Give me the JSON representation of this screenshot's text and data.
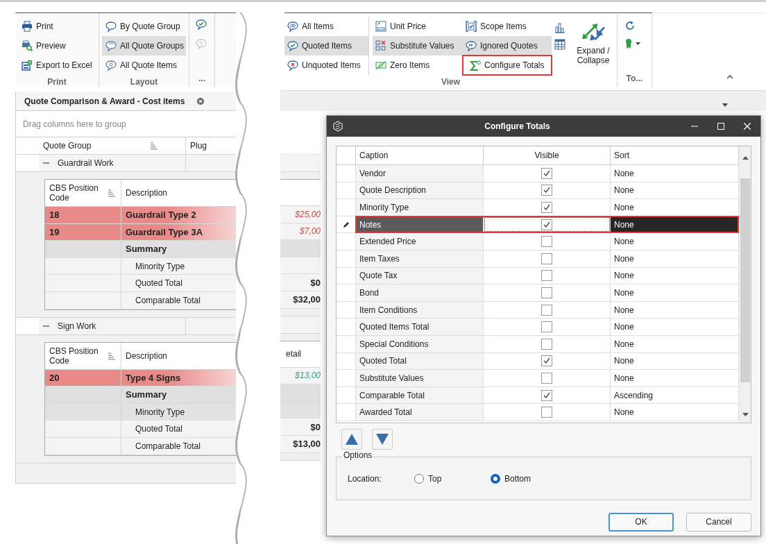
{
  "left_ribbon": {
    "groups": [
      {
        "label": "Print",
        "items": [
          {
            "label": "Print"
          },
          {
            "label": "Preview"
          },
          {
            "label": "Export to Excel"
          }
        ]
      },
      {
        "label": "Layout",
        "items": [
          {
            "label": "By Quote Group",
            "selected": false
          },
          {
            "label": "All Quote Groups",
            "selected": true
          },
          {
            "label": "All Quote Items",
            "selected": false
          }
        ]
      },
      {
        "label": "..."
      }
    ]
  },
  "document_tab": {
    "title": "Quote Comparison & Award - Cost items"
  },
  "group_panel": {
    "hint": "Drag columns here to group"
  },
  "grid": {
    "columns": [
      "Quote Group",
      "Plug"
    ],
    "groups": [
      {
        "name": "Guardrail Work",
        "expanded": true,
        "detail_columns": [
          "CBS Position Code",
          "Description"
        ],
        "rows": [
          {
            "kind": "item",
            "code": "18",
            "description": "Guardrail Type 2",
            "amount": "$25,00",
            "color": "#c0504d",
            "selected": false
          },
          {
            "kind": "item",
            "code": "19",
            "description": "Guardrail Type 3A",
            "amount": "$7,00",
            "color": "#c0504d",
            "selected": false
          },
          {
            "kind": "summary",
            "description": "Summary",
            "selected": false
          },
          {
            "kind": "total",
            "description": "Minority Type",
            "selected": false
          },
          {
            "kind": "total",
            "description": "Quoted Total",
            "amount": "$0",
            "selected": false
          },
          {
            "kind": "total",
            "description": "Comparable Total",
            "amount": "$32,00",
            "selected": false
          }
        ]
      },
      {
        "name": "Sign Work",
        "expanded": true,
        "detail_columns": [
          "CBS Position Code",
          "Description",
          "etail"
        ],
        "rows": [
          {
            "kind": "item",
            "code": "20",
            "description": "Type 4 Signs",
            "amount": "$13,00",
            "color": "#3a9a8a",
            "selected": false
          },
          {
            "kind": "summary",
            "description": "Summary",
            "selected": false
          },
          {
            "kind": "total",
            "description": "Minority Type",
            "selected": true
          },
          {
            "kind": "total",
            "description": "Quoted Total",
            "amount": "$0",
            "selected": false
          },
          {
            "kind": "total",
            "description": "Comparable Total",
            "amount": "$13,00",
            "selected": false
          }
        ]
      }
    ]
  },
  "right_ribbon": {
    "view_group": {
      "label": "View",
      "columns": [
        [
          {
            "label": "All Items",
            "selected": false,
            "highlighted": false
          },
          {
            "label": "Quoted Items",
            "selected": true,
            "highlighted": false
          },
          {
            "label": "Unquoted Items",
            "selected": false,
            "highlighted": false
          }
        ],
        [
          {
            "label": "Unit Price",
            "selected": false,
            "highlighted": false
          },
          {
            "label": "Substitute Values",
            "selected": true,
            "highlighted": false
          },
          {
            "label": "Zero Items",
            "selected": false,
            "highlighted": false
          }
        ],
        [
          {
            "label": "Scope Items",
            "selected": false,
            "highlighted": false
          },
          {
            "label": "Ignored Quotes",
            "selected": true,
            "highlighted": false
          },
          {
            "label": "Configure Totals",
            "selected": false,
            "highlighted": true
          }
        ]
      ],
      "expand_button": {
        "label": "Expand / Collapse"
      }
    },
    "tools_group": {
      "label": "To..."
    }
  },
  "dialog": {
    "title": "Configure Totals",
    "columns": [
      "Caption",
      "Visible",
      "Sort"
    ],
    "rows": [
      {
        "caption": "Vendor",
        "visible": true,
        "sort": "None",
        "selected": false,
        "highlighted": false
      },
      {
        "caption": "Quote Description",
        "visible": true,
        "sort": "None",
        "selected": false,
        "highlighted": false
      },
      {
        "caption": "Minority Type",
        "visible": true,
        "sort": "None",
        "selected": false,
        "highlighted": false
      },
      {
        "caption": "Notes",
        "visible": true,
        "sort": "None",
        "selected": true,
        "highlighted": true
      },
      {
        "caption": "Extended Price",
        "visible": false,
        "sort": "None",
        "selected": false,
        "highlighted": false
      },
      {
        "caption": "Item Taxes",
        "visible": false,
        "sort": "None",
        "selected": false,
        "highlighted": false
      },
      {
        "caption": "Quote Tax",
        "visible": false,
        "sort": "None",
        "selected": false,
        "highlighted": false
      },
      {
        "caption": "Bond",
        "visible": false,
        "sort": "None",
        "selected": false,
        "highlighted": false
      },
      {
        "caption": "Item Conditions",
        "visible": false,
        "sort": "None",
        "selected": false,
        "highlighted": false
      },
      {
        "caption": "Quoted Items Total",
        "visible": false,
        "sort": "None",
        "selected": false,
        "highlighted": false
      },
      {
        "caption": "Special Conditions",
        "visible": false,
        "sort": "None",
        "selected": false,
        "highlighted": false
      },
      {
        "caption": "Quoted Total",
        "visible": true,
        "sort": "None",
        "selected": false,
        "highlighted": false
      },
      {
        "caption": "Substitute Values",
        "visible": false,
        "sort": "None",
        "selected": false,
        "highlighted": false
      },
      {
        "caption": "Comparable Total",
        "visible": true,
        "sort": "Ascending",
        "selected": false,
        "highlighted": false
      },
      {
        "caption": "Awarded Total",
        "visible": false,
        "sort": "None",
        "selected": false,
        "highlighted": false
      }
    ],
    "options": {
      "legend": "Options",
      "location_label": "Location:",
      "choices": [
        {
          "label": "Top",
          "selected": false
        },
        {
          "label": "Bottom",
          "selected": true
        }
      ]
    },
    "buttons": [
      {
        "label": "OK",
        "default": true
      },
      {
        "label": "Cancel",
        "default": false
      }
    ]
  }
}
